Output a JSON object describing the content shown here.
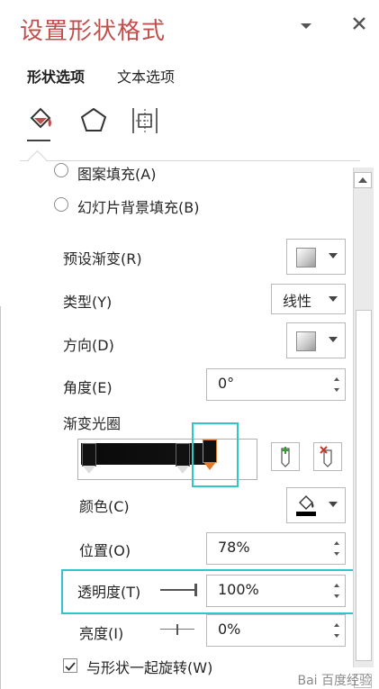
{
  "header": {
    "title": "设置形状格式",
    "menu_icon": "chevron-down",
    "close_icon": "close"
  },
  "tabs": [
    {
      "label": "形状选项",
      "active": true
    },
    {
      "label": "文本选项",
      "active": false
    }
  ],
  "category_icons": [
    "paint-bucket-icon",
    "pentagon-icon",
    "size-properties-icon"
  ],
  "fill": {
    "pattern_fill_label": "图案填充(A)",
    "slide_background_fill_label": "幻灯片背景填充(B)"
  },
  "gradient": {
    "preset_label": "预设渐变(R)",
    "type_label": "类型(Y)",
    "type_value": "线性",
    "direction_label": "方向(D)",
    "angle_label": "角度(E)",
    "angle_value": "0°",
    "stops_label": "渐变光圈",
    "color_label": "颜色(C)",
    "position_label": "位置(O)",
    "position_value": "78%",
    "transparency_label": "透明度(T)",
    "transparency_value": "100%",
    "brightness_label": "亮度(I)",
    "brightness_value": "0%",
    "rotate_with_shape_label": "与形状一起旋转(W)",
    "rotate_with_shape_checked": true
  },
  "colors": {
    "title": "#c0504d",
    "highlight": "#30c6c6",
    "selected_stop": "#e07a2e"
  },
  "watermark": "Bai 百度经验"
}
